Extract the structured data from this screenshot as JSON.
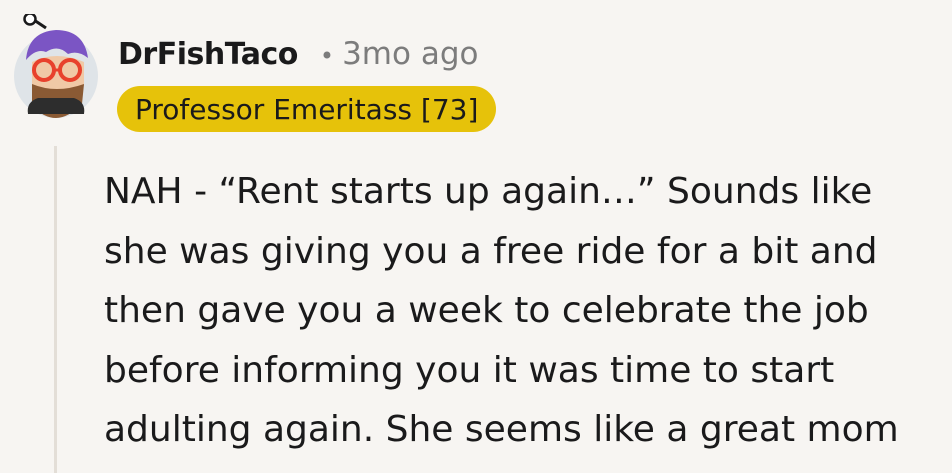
{
  "comment": {
    "username": "DrFishTaco",
    "separator": "•",
    "timestamp": "3mo ago",
    "flair": "Professor Emeritass [73]",
    "body_lines": [
      "NAH - “Rent starts up again…” Sounds like",
      "she was giving you a free ride for a bit and",
      "then gave you a week to celebrate the job",
      "before informing you it was time to start",
      "adulting again. She seems like a great mom"
    ]
  },
  "colors": {
    "background": "#f7f5f2",
    "flair_background": "#e6c20a",
    "avatar_background": "#dfe4e8",
    "avatar_hair": "#7b55c4",
    "avatar_glasses": "#e8412c",
    "muted_text": "#7c7c7c",
    "thread_line": "#e3ded7"
  },
  "icons": {
    "avatar": "snoo-avatar-icon"
  }
}
